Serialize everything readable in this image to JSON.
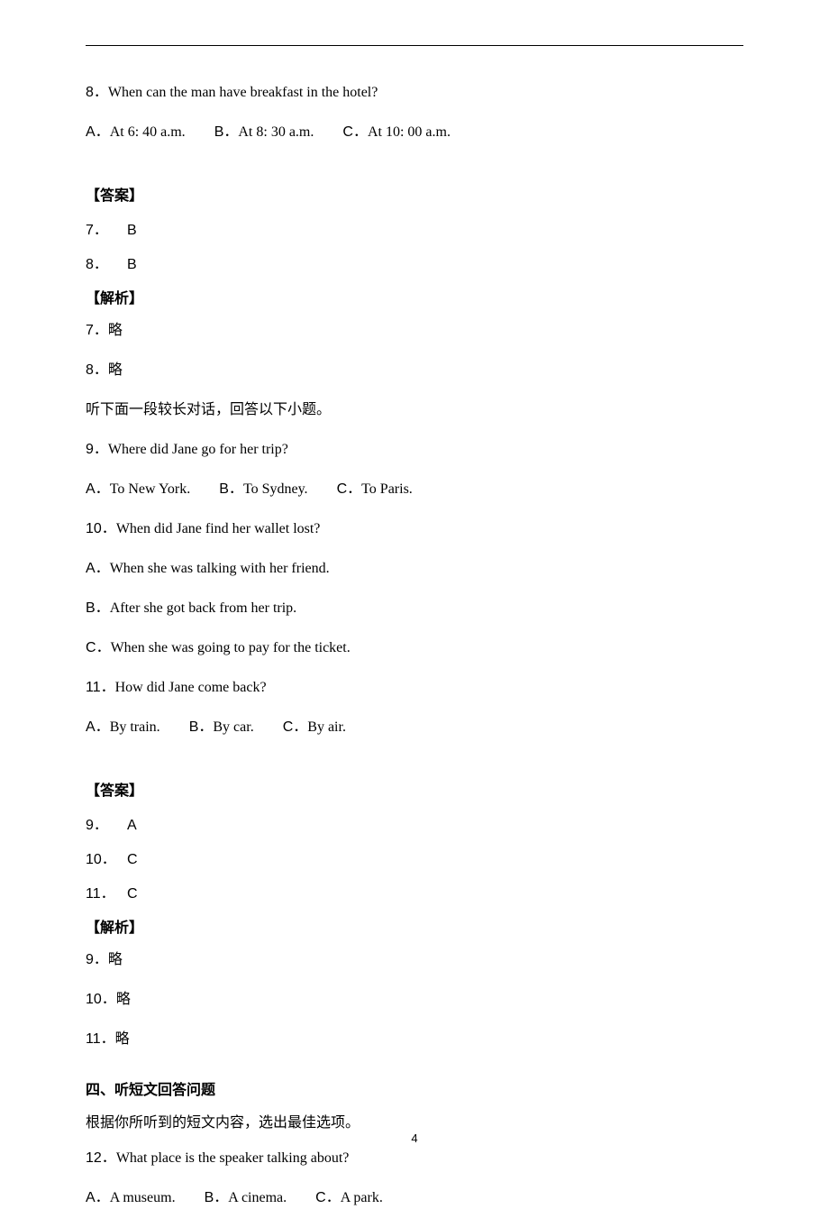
{
  "page_number": "4",
  "q8": {
    "num": "8",
    "text": "When can the man have breakfast in the hotel?",
    "options": [
      {
        "label": "A",
        "text": "At 6: 40 a.m."
      },
      {
        "label": "B",
        "text": "At 8: 30 a.m."
      },
      {
        "label": "C",
        "text": "At 10: 00 a.m."
      }
    ]
  },
  "answers1": {
    "heading": "【答案】",
    "items": [
      {
        "num": "7",
        "val": "B"
      },
      {
        "num": "8",
        "val": "B"
      }
    ]
  },
  "analysis1": {
    "heading": "【解析】",
    "items": [
      {
        "num": "7",
        "val": "略"
      },
      {
        "num": "8",
        "val": "略"
      }
    ]
  },
  "dialog_intro": "听下面一段较长对话，回答以下小题。",
  "q9": {
    "num": "9",
    "text": "Where did Jane go for her trip?",
    "options": [
      {
        "label": "A",
        "text": "To New York."
      },
      {
        "label": "B",
        "text": "To Sydney."
      },
      {
        "label": "C",
        "text": "To Paris."
      }
    ]
  },
  "q10": {
    "num": "10",
    "text": "When did Jane find her wallet lost?",
    "options": [
      {
        "label": "A",
        "text": "When she was talking with her friend."
      },
      {
        "label": "B",
        "text": "After she got back from her trip."
      },
      {
        "label": "C",
        "text": "When she was going to pay for the ticket."
      }
    ]
  },
  "q11": {
    "num": "11",
    "text": "How did Jane come back?",
    "options": [
      {
        "label": "A",
        "text": "By train."
      },
      {
        "label": "B",
        "text": "By car."
      },
      {
        "label": "C",
        "text": "By air."
      }
    ]
  },
  "answers2": {
    "heading": "【答案】",
    "items": [
      {
        "num": "9",
        "val": "A"
      },
      {
        "num": "10",
        "val": "C"
      },
      {
        "num": "11",
        "val": "C"
      }
    ]
  },
  "analysis2": {
    "heading": "【解析】",
    "items": [
      {
        "num": "9",
        "val": "略"
      },
      {
        "num": "10",
        "val": "略"
      },
      {
        "num": "11",
        "val": "略"
      }
    ]
  },
  "section4": {
    "title": "四、听短文回答问题",
    "instruction": "根据你所听到的短文内容，选出最佳选项。"
  },
  "q12": {
    "num": "12",
    "text": "What place is the speaker talking about?",
    "options": [
      {
        "label": "A",
        "text": "A museum."
      },
      {
        "label": "B",
        "text": "A cinema."
      },
      {
        "label": "C",
        "text": "A park."
      }
    ]
  }
}
